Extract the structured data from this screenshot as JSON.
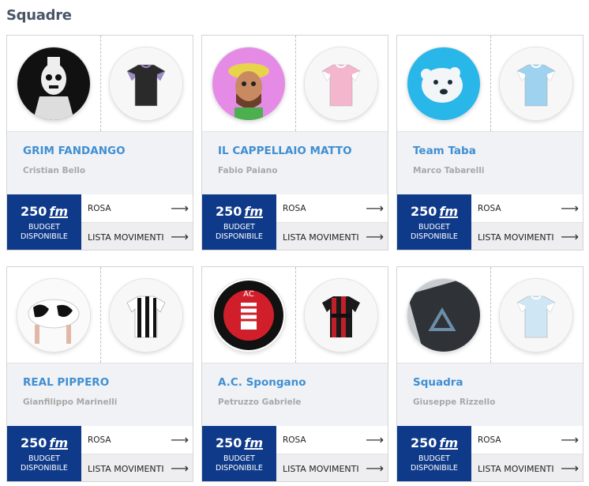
{
  "page": {
    "title": "Squadre"
  },
  "labels": {
    "currency_suffix": "fm",
    "budget_label": "BUDGET DISPONIBILE",
    "rosa": "ROSA",
    "movimenti": "LISTA MOVIMENTI"
  },
  "teams": [
    {
      "name": "GRIM FANDANGO",
      "owner": "Cristian Bello",
      "budget": "250",
      "logo_icon": "skeleton-logo-icon",
      "kit_icon": "black-purple-jersey-icon",
      "kit_colors": [
        "#2a2a2a",
        "#9b8ac4"
      ]
    },
    {
      "name": "IL CAPPELLAIO MATTO",
      "owner": "Fabio Paiano",
      "budget": "250",
      "logo_icon": "mad-hatter-logo-icon",
      "kit_icon": "pink-white-jersey-icon",
      "kit_colors": [
        "#f4b6cc",
        "#ffffff"
      ]
    },
    {
      "name": "Team Taba",
      "owner": "Marco Tabarelli",
      "budget": "250",
      "logo_icon": "polar-bear-logo-icon",
      "kit_icon": "sky-blue-jersey-icon",
      "kit_colors": [
        "#9fd2ee",
        "#ffffff"
      ]
    },
    {
      "name": "REAL PIPPERO",
      "owner": "Gianfilippo Marinelli",
      "budget": "250",
      "logo_icon": "cow-logo-icon",
      "kit_icon": "black-white-stripes-jersey-icon",
      "kit_colors": [
        "#111111",
        "#ffffff"
      ]
    },
    {
      "name": "A.C. Spongano",
      "owner": "Petruzzo Gabriele",
      "budget": "250",
      "logo_icon": "red-crest-logo-icon",
      "kit_icon": "red-black-jersey-icon",
      "kit_colors": [
        "#c0202a",
        "#1a1a1a"
      ]
    },
    {
      "name": "Squadra",
      "owner": "Giuseppe Rizzello",
      "budget": "250",
      "logo_icon": "dark-photo-logo-icon",
      "kit_icon": "light-blue-jersey-icon",
      "kit_colors": [
        "#cfe6f5",
        "#ffffff"
      ]
    }
  ]
}
